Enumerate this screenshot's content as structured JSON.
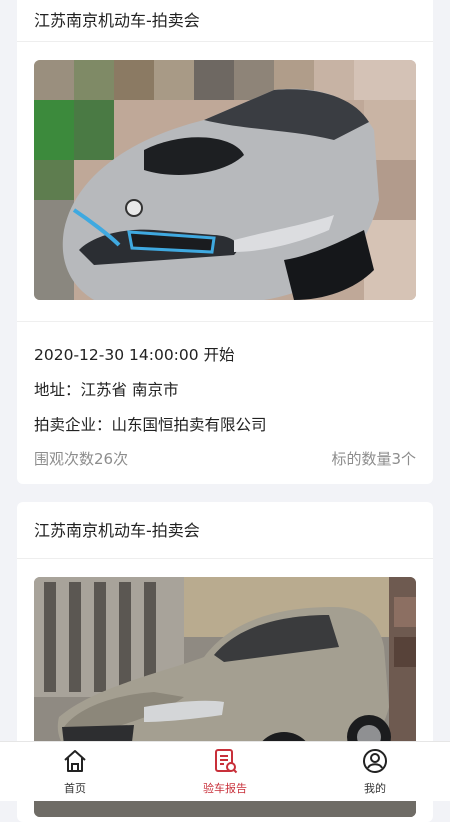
{
  "listings": [
    {
      "title": "江苏南京机动车-拍卖会",
      "start_time": "2020-12-30 14:00:00 开始",
      "address_label": "地址：",
      "address_value": "江苏省 南京市",
      "company_label": "拍卖企业：",
      "company_value": "山东国恒拍卖有限公司",
      "views": "围观次数26次",
      "lots": "标的数量3个"
    },
    {
      "title": "江苏南京机动车-拍卖会"
    }
  ],
  "tabbar": {
    "items": [
      {
        "label": "首页",
        "icon": "home-icon"
      },
      {
        "label": "验车报告",
        "icon": "report-icon",
        "active": true
      },
      {
        "label": "我的",
        "icon": "user-icon"
      }
    ],
    "active_color": "#c8303a"
  }
}
